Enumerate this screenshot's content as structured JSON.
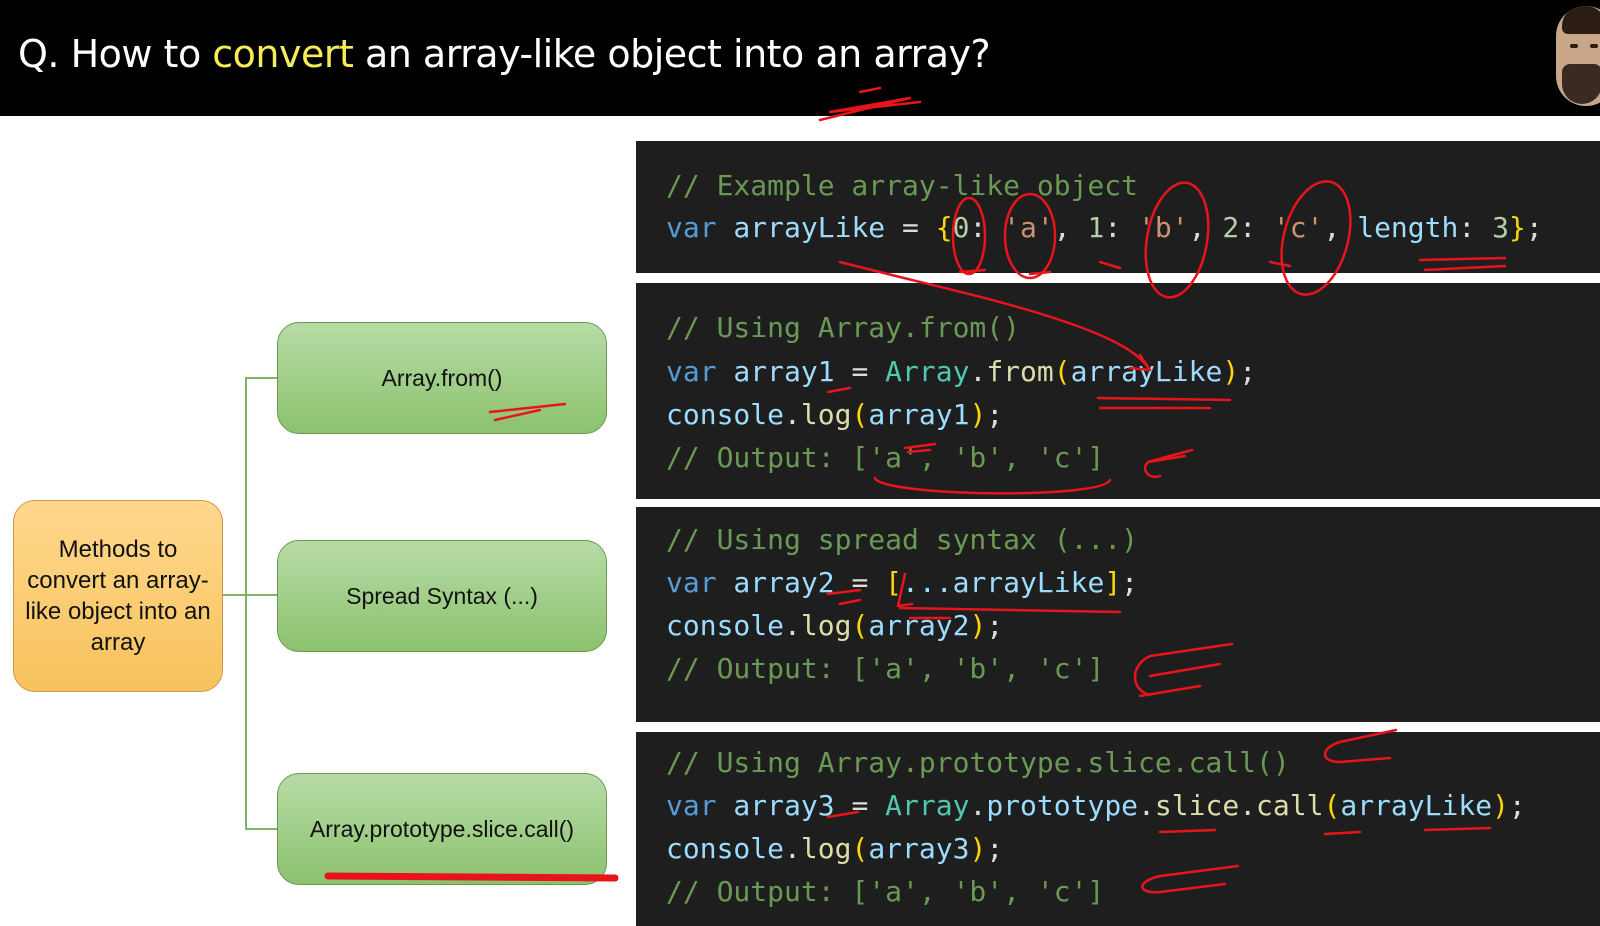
{
  "header": {
    "title_prefix": "Q. How to ",
    "title_highlight": "convert",
    "title_suffix": " an array-like object into an array?",
    "highlight_color": "#f5ec5a"
  },
  "diagram": {
    "root": "Methods to convert an array-like object into an array",
    "methods": [
      {
        "label": "Array.from()"
      },
      {
        "label": "Spread Syntax (...)"
      },
      {
        "label": "Array.prototype.slice.call()"
      }
    ]
  },
  "code": {
    "block1": {
      "comment": "// Example array-like object",
      "line": [
        "var",
        " arrayLike ",
        "=",
        " {",
        "0",
        ": ",
        "'a'",
        ", ",
        "1",
        ": ",
        "'b'",
        ", ",
        "2",
        ": ",
        "'c'",
        ", ",
        "length",
        ": ",
        "3",
        "}",
        ";"
      ]
    },
    "block2": {
      "comment": "// Using Array.from()",
      "line1": [
        "var",
        " array1 ",
        "=",
        " Array",
        ".",
        "from",
        "(",
        "arrayLike",
        ")",
        ";"
      ],
      "line2": [
        "console",
        ".",
        "log",
        "(",
        "array1",
        ")",
        ";"
      ],
      "output": "// Output: ['a', 'b', 'c']"
    },
    "block3": {
      "comment": "// Using spread syntax (...)",
      "line1": [
        "var",
        " array2 ",
        "=",
        " ",
        "[",
        "...arrayLike",
        "]",
        ";"
      ],
      "line2": [
        "console",
        ".",
        "log",
        "(",
        "array2",
        ")",
        ";"
      ],
      "output": "// Output: ['a', 'b', 'c']"
    },
    "block4": {
      "comment": "// Using Array.prototype.slice.call()",
      "line1": [
        "var",
        " array3 ",
        "=",
        " Array",
        ".",
        "prototype",
        ".",
        "slice",
        ".",
        "call",
        "(",
        "arrayLike",
        ")",
        ";"
      ],
      "line2": [
        "console",
        ".",
        "log",
        "(",
        "array3",
        ")",
        ";"
      ],
      "output": "// Output: ['a', 'b', 'c']"
    }
  },
  "colors": {
    "code_bg": "#1e1e1e",
    "comment": "#6a9955",
    "keyword": "#569cd6",
    "type": "#4ec9b0",
    "function": "#dcdcaa",
    "string": "#ce9178",
    "number": "#b5cea8",
    "bracket": "#ffd700",
    "annotation": "#e8141c",
    "method_box": "#a6d190",
    "root_box": "#fcc96e"
  }
}
